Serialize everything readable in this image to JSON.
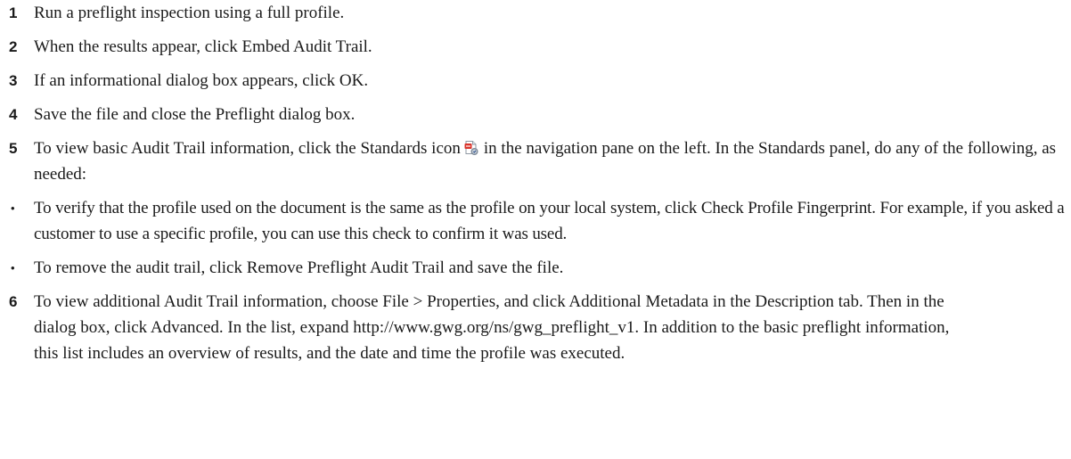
{
  "steps": [
    {
      "marker": "1",
      "text": "Run a preflight inspection using a full profile."
    },
    {
      "marker": "2",
      "text": "When the results appear, click Embed Audit Trail."
    },
    {
      "marker": "3",
      "text": "If an informational dialog box appears, click OK."
    },
    {
      "marker": "4",
      "text": "Save the file and close the Preflight dialog box."
    },
    {
      "marker": "5",
      "text_before": "To view basic Audit Trail information, click the Standards icon",
      "icon": "standards-icon",
      "text_after": "in the navigation pane on the left. In the Standards panel, do any of the following, as needed:"
    },
    {
      "marker": "•",
      "text": "To verify that the profile used on the document is the same as the profile on your local system, click Check Profile Fingerprint. For example, if you asked a customer to use a specific profile, you can use this check to confirm it was used."
    },
    {
      "marker": "•",
      "text": "To remove the audit trail, click Remove Preflight Audit Trail and save the file."
    },
    {
      "marker": "6",
      "text": "To view additional Audit Trail information, choose File > Properties, and click Additional Metadata in the Description tab. Then in the dialog box, click Advanced. In the list, expand http://www.gwg.org/ns/gwg_preflight_v1. In addition to the basic preflight information, this list includes an overview of results, and the date and time the profile was executed."
    }
  ],
  "colors": {
    "text": "#1a1a1a",
    "icon_red": "#d9342b",
    "icon_grey": "#9aa3ad"
  }
}
